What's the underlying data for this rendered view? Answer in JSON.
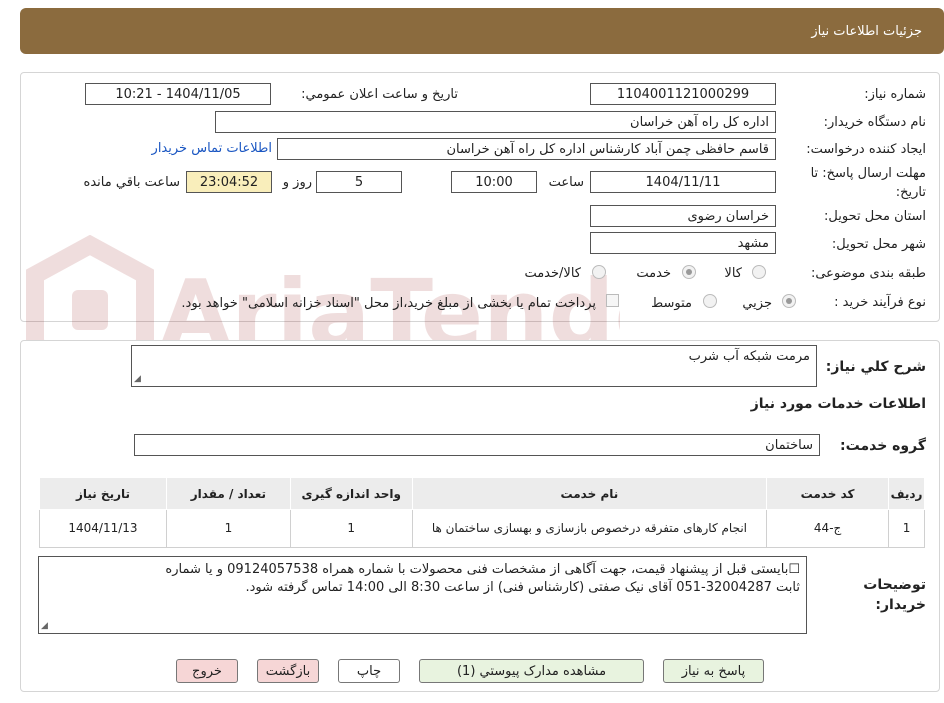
{
  "header": {
    "title": "جزئیات اطلاعات نیاز"
  },
  "form": {
    "need_number_label": "شماره نیاز:",
    "need_number": "1104001121000299",
    "announce_label": "تاریخ و ساعت اعلان عمومي:",
    "announce_value": "1404/11/05 - 10:21",
    "buyer_org_label": "نام دستگاه خریدار:",
    "buyer_org": "اداره کل راه آهن خراسان",
    "requester_label": "ایجاد کننده درخواست:",
    "requester": "قاسم حافظی چمن آباد کارشناس اداره کل راه آهن خراسان",
    "contact_link": "اطلاعات تماس خریدار",
    "deadline_label": "مهلت ارسال پاسخ: تا تاریخ:",
    "deadline_date": "1404/11/11",
    "time_label": "ساعت",
    "deadline_time": "10:00",
    "days_value": "5",
    "days_label": "روز و",
    "remaining_time": "23:04:52",
    "remaining_label": "ساعت باقي مانده",
    "province_label": "استان محل تحویل:",
    "province": "خراسان رضوی",
    "city_label": "شهر محل تحویل:",
    "city": "مشهد",
    "category_label": "طبقه بندی موضوعی:",
    "category_options": [
      "کالا",
      "خدمت",
      "کالا/خدمت"
    ],
    "category_selected": "خدمت",
    "process_label": "نوع فرآیند خرید :",
    "process_options": [
      "جزيي",
      "متوسط"
    ],
    "process_selected": "جزيي",
    "payment_note": "پرداخت تمام یا بخشی از مبلغ خرید،از محل \"اسناد خزانه اسلامی\" خواهد بود."
  },
  "summary": {
    "label": "شرح کلي نياز:",
    "value": "مرمت شبکه آب شرب"
  },
  "services": {
    "section_title": "اطلاعات خدمات مورد نياز",
    "group_label": "گروه خدمت:",
    "group_value": "ساختمان",
    "columns": [
      "ردیف",
      "کد خدمت",
      "نام خدمت",
      "واحد اندازه گیری",
      "تعداد / مقدار",
      "تاریخ نیاز"
    ],
    "rows": [
      {
        "row": "1",
        "code": "ج-44",
        "name": "انجام کارهای متفرقه درخصوص بازسازی و بهسازی ساختمان ها",
        "unit": "1",
        "quantity": "1",
        "date": "1404/11/13"
      }
    ]
  },
  "notes": {
    "label": "توضیحات خریدار:",
    "line1": "بایستی قبل از پیشنهاد قیمت، جهت آگاهی از مشخصات فنی محصولات با شماره همراه   09124057538  و یا شماره",
    "line2": "ثابت 32004287-051 آقای نیک صفتی (کارشناس فنی) از ساعت 8:30  الی 14:00  تماس گرفته شود."
  },
  "buttons": {
    "reply": "پاسخ به نیاز",
    "attachments": "مشاهده مدارک پیوستي (1)",
    "print": "چاپ",
    "back": "بازگشت",
    "exit": "خروج"
  },
  "watermark": {
    "text": "AriaTender.neT"
  },
  "colors": {
    "header": "#8b6b3e",
    "highlight": "#f9eebb",
    "link": "#1a56c2"
  }
}
